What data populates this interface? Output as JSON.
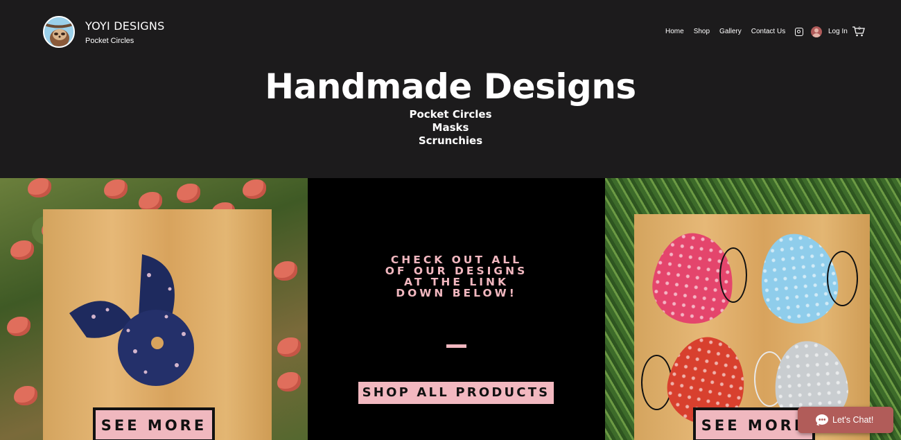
{
  "brand": {
    "title": "YOYI DESIGNS",
    "subtitle": "Pocket Circles"
  },
  "nav": {
    "items": [
      "Home",
      "Shop",
      "Gallery",
      "Contact Us"
    ]
  },
  "header_actions": {
    "login_label": "Log In",
    "cart_count": "0"
  },
  "hero": {
    "title": "Handmade Designs",
    "lines": [
      "Pocket Circles",
      "Masks",
      "Scrunchies"
    ]
  },
  "left_panel": {
    "button_label": "SEE MORE"
  },
  "middle_panel": {
    "cta_lines": [
      "CHECK OUT ALL",
      "OF OUR DESIGNS",
      "AT THE LINK",
      "DOWN BELOW!"
    ],
    "shop_all_label": "SHOP ALL PRODUCTS"
  },
  "right_panel": {
    "button_label": "SEE MORE"
  },
  "chat": {
    "label": "Let's Chat!"
  },
  "colors": {
    "header_bg": "#1c1b1c",
    "accent_pink": "#f2b8c0",
    "chat_bg": "#b15c59"
  },
  "icons": [
    "sloth-logo",
    "instagram-icon",
    "user-avatar-icon",
    "cart-icon",
    "chat-bubble-icon"
  ]
}
